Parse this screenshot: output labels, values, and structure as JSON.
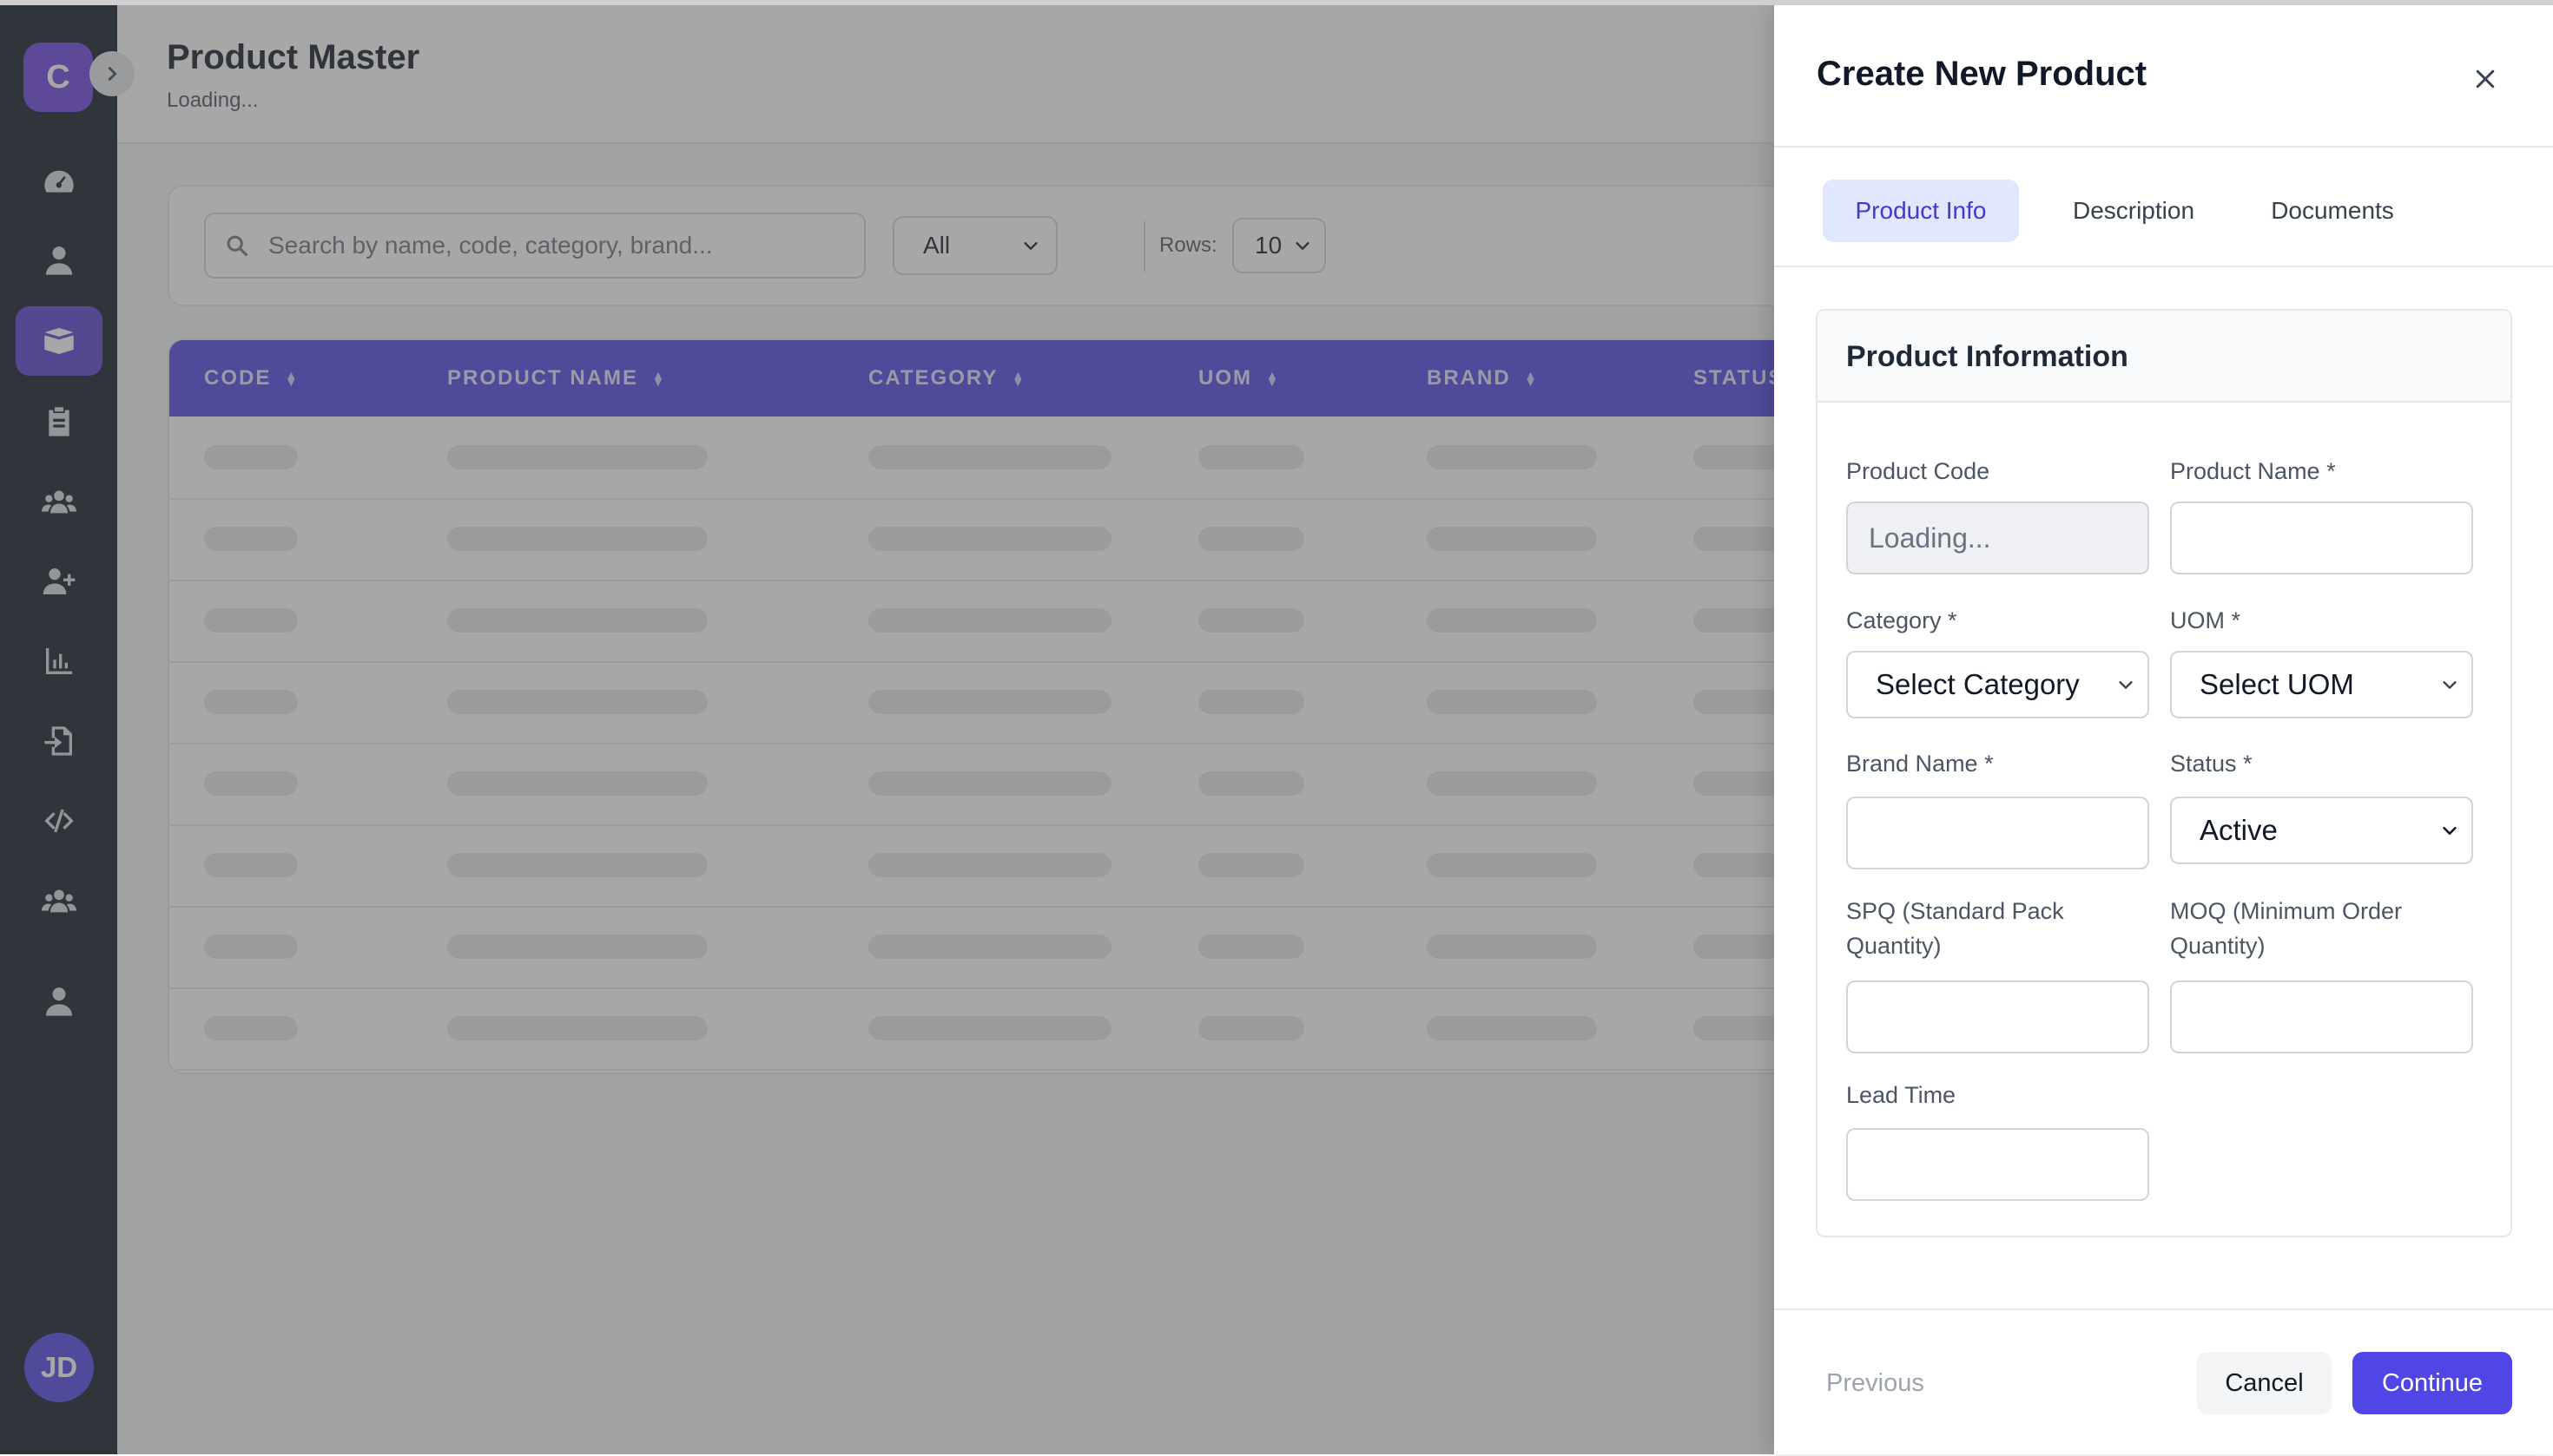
{
  "app": {
    "logo_letter": "C",
    "user_initials": "JD"
  },
  "sidebar": {
    "items": [
      {
        "icon": "dashboard-icon",
        "active": false
      },
      {
        "icon": "user-icon",
        "active": false
      },
      {
        "icon": "box-icon",
        "active": true
      },
      {
        "icon": "clipboard-icon",
        "active": false
      },
      {
        "icon": "users-icon",
        "active": false
      },
      {
        "icon": "user-plus-icon",
        "active": false
      },
      {
        "icon": "bar-chart-icon",
        "active": false
      },
      {
        "icon": "file-import-icon",
        "active": false
      },
      {
        "icon": "code-icon",
        "active": false
      },
      {
        "icon": "users-icon",
        "active": false
      },
      {
        "icon": "user-icon",
        "active": false
      }
    ]
  },
  "page": {
    "title": "Product Master",
    "subtitle": "Loading..."
  },
  "filters": {
    "search_placeholder": "Search by name, code, category, brand...",
    "status_filter_value": "All",
    "rows_label": "Rows:",
    "rows_value": "10"
  },
  "table": {
    "columns": [
      "CODE",
      "PRODUCT NAME",
      "CATEGORY",
      "UOM",
      "BRAND",
      "STATUS"
    ],
    "skeleton_rows": 8
  },
  "drawer": {
    "title": "Create New Product",
    "tabs": [
      {
        "label": "Product Info",
        "active": true
      },
      {
        "label": "Description",
        "active": false
      },
      {
        "label": "Documents",
        "active": false
      }
    ],
    "section_title": "Product Information",
    "fields": {
      "product_code": {
        "label": "Product Code",
        "value": "Loading..."
      },
      "product_name": {
        "label": "Product Name *",
        "value": ""
      },
      "category": {
        "label": "Category *",
        "value": "Select Category"
      },
      "uom": {
        "label": "UOM *",
        "value": "Select UOM"
      },
      "brand_name": {
        "label": "Brand Name *",
        "value": ""
      },
      "status": {
        "label": "Status *",
        "value": "Active"
      },
      "spq": {
        "label_line1": "SPQ (Standard Pack",
        "label_line2": "Quantity)",
        "value": ""
      },
      "moq": {
        "label_line1": "MOQ (Minimum Order",
        "label_line2": "Quantity)",
        "value": ""
      },
      "lead_time": {
        "label": "Lead Time",
        "value": ""
      }
    },
    "footer": {
      "previous": "Previous",
      "cancel": "Cancel",
      "continue": "Continue"
    }
  },
  "colors": {
    "accent": "#4f46e5",
    "sidebar_bg": "#111827",
    "logo": "#6d40e0"
  }
}
